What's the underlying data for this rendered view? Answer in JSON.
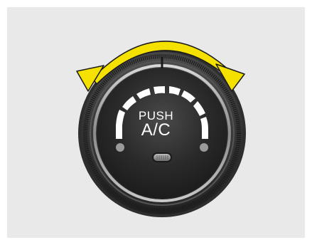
{
  "knob": {
    "label_line1": "PUSH",
    "label_line2": "A/C",
    "arrow_color": "#f5e100",
    "arrow_outline": "#1a1a1a",
    "indicator_color": "#ffffff",
    "face_color": "#2b2b2b",
    "ring_color": "#3a3a3a",
    "background_color": "#e9e9e9",
    "rotation_indicator_icon": "double-arrow-rotate-icon",
    "status_light_icon": "pill-light-icon"
  }
}
